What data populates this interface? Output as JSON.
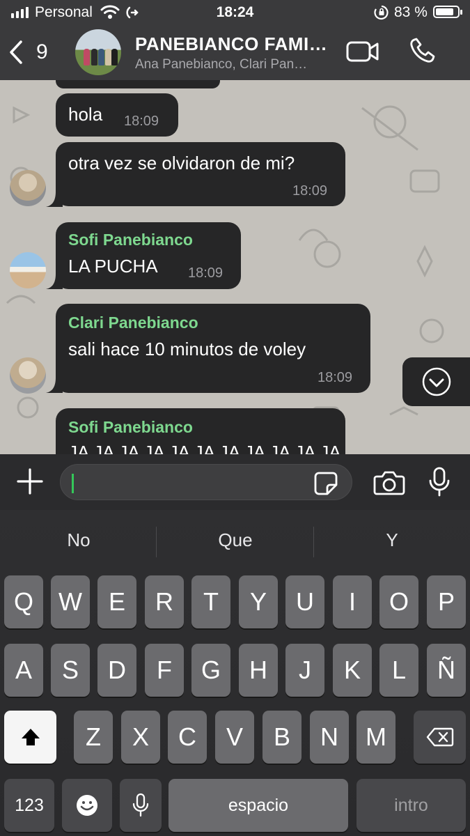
{
  "status": {
    "carrier": "Personal",
    "time": "18:24",
    "battery_pct": "83 %",
    "battery_level": 0.83
  },
  "header": {
    "back_count": "9",
    "title": "PANEBIANCO FAMI…",
    "subtitle": "Ana Panebianco, Clari Pan…"
  },
  "messages": [
    {
      "text": "hola",
      "time": "18:09"
    },
    {
      "text": "otra vez se olvidaron de mi?",
      "time": "18:09"
    },
    {
      "sender": "Sofi Panebianco",
      "text": "LA PUCHA",
      "time": "18:09"
    },
    {
      "sender": "Clari Panebianco",
      "text": "sali hace 10 minutos de voley",
      "time": "18:09"
    },
    {
      "sender": "Sofi Panebianco",
      "text": "JA JA JA JA JA JA JA JA JA JA JA"
    }
  ],
  "composer": {
    "value": ""
  },
  "keyboard": {
    "suggestions": [
      "No",
      "Que",
      "Y"
    ],
    "row1": [
      "Q",
      "W",
      "E",
      "R",
      "T",
      "Y",
      "U",
      "I",
      "O",
      "P"
    ],
    "row2": [
      "A",
      "S",
      "D",
      "F",
      "G",
      "H",
      "J",
      "K",
      "L",
      "Ñ"
    ],
    "row3": [
      "Z",
      "X",
      "C",
      "V",
      "B",
      "N",
      "M"
    ],
    "numbers_label": "123",
    "space_label": "espacio",
    "return_label": "intro"
  },
  "colors": {
    "sender_name": "#7ed88f",
    "bubble": "#262627",
    "chat_background": "#c4c1bb",
    "caret": "#34c759"
  }
}
